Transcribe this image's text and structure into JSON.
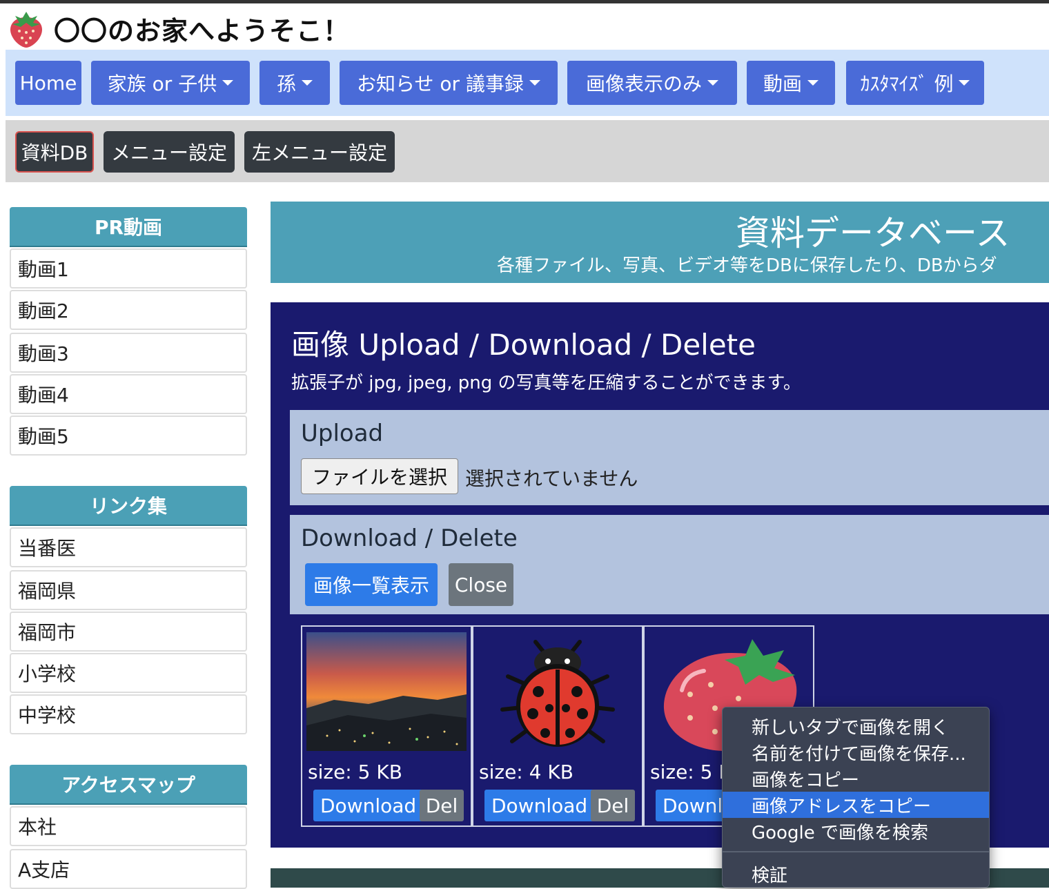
{
  "site": {
    "title": "〇〇のお家へようそこ！"
  },
  "nav_main": [
    {
      "label": "Home"
    },
    {
      "label": "家族 or 子供"
    },
    {
      "label": "孫"
    },
    {
      "label": "お知らせ or 議事録"
    },
    {
      "label": "画像表示のみ"
    },
    {
      "label": "動画"
    },
    {
      "label": "ｶｽﾀﾏｲｽﾞ 例"
    }
  ],
  "nav_sub": [
    {
      "label": "資料DB"
    },
    {
      "label": "メニュー設定"
    },
    {
      "label": "左メニュー設定"
    }
  ],
  "sidebar": {
    "videos": {
      "heading": "PR動画",
      "items": [
        "動画1",
        "動画2",
        "動画3",
        "動画4",
        "動画5"
      ]
    },
    "links": {
      "heading": "リンク集",
      "items": [
        "当番医",
        "福岡県",
        "福岡市",
        "小学校",
        "中学校"
      ]
    },
    "access": {
      "heading": "アクセスマップ",
      "items": [
        "本社",
        "A支店"
      ]
    }
  },
  "banner": {
    "title": "資料データベース",
    "subtitle": "各種ファイル、写真、ビデオ等をDBに保存したり、DBからダ"
  },
  "panel": {
    "title": "画像 Upload / Download / Delete",
    "subtitle": "拡張子が jpg, jpeg, png の写真等を圧縮することができます。",
    "upload": {
      "heading": "Upload",
      "file_button": "ファイルを選択",
      "no_file": "選択されていません"
    },
    "download": {
      "heading": "Download / Delete",
      "list_button": "画像一覧表示",
      "close_button": "Close"
    },
    "images": [
      {
        "size": "size: 5 KB",
        "download": "Download",
        "delete": "Del"
      },
      {
        "size": "size: 4 KB",
        "download": "Download",
        "delete": "Del"
      },
      {
        "size": "size: 5 K",
        "download": "Downl"
      }
    ]
  },
  "context_menu": {
    "items": [
      "新しいタブで画像を開く",
      "名前を付けて画像を保存...",
      "画像をコピー",
      "画像アドレスをコピー",
      "Google で画像を検索"
    ],
    "inspect": "検証"
  },
  "colors": {
    "nav_button": "#4a6bd8",
    "sidebar_header": "#4ba0b6",
    "panel_bg": "#1a1a6e",
    "card_bg": "#b3c3de",
    "primary": "#2d7be8",
    "menu_highlight": "#2f6fdc"
  }
}
